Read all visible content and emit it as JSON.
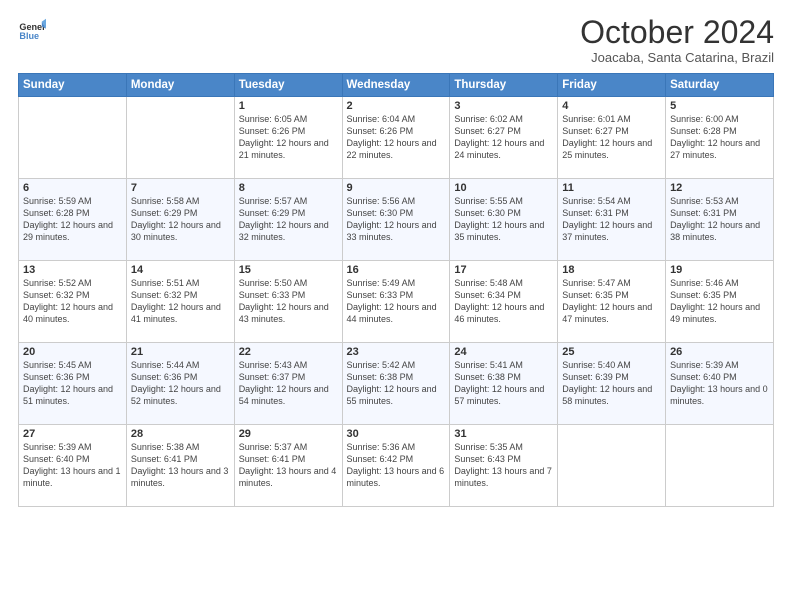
{
  "logo": {
    "line1": "General",
    "line2": "Blue"
  },
  "title": "October 2024",
  "location": "Joacaba, Santa Catarina, Brazil",
  "days_of_week": [
    "Sunday",
    "Monday",
    "Tuesday",
    "Wednesday",
    "Thursday",
    "Friday",
    "Saturday"
  ],
  "weeks": [
    [
      {
        "day": "",
        "info": ""
      },
      {
        "day": "",
        "info": ""
      },
      {
        "day": "1",
        "info": "Sunrise: 6:05 AM\nSunset: 6:26 PM\nDaylight: 12 hours and 21 minutes."
      },
      {
        "day": "2",
        "info": "Sunrise: 6:04 AM\nSunset: 6:26 PM\nDaylight: 12 hours and 22 minutes."
      },
      {
        "day": "3",
        "info": "Sunrise: 6:02 AM\nSunset: 6:27 PM\nDaylight: 12 hours and 24 minutes."
      },
      {
        "day": "4",
        "info": "Sunrise: 6:01 AM\nSunset: 6:27 PM\nDaylight: 12 hours and 25 minutes."
      },
      {
        "day": "5",
        "info": "Sunrise: 6:00 AM\nSunset: 6:28 PM\nDaylight: 12 hours and 27 minutes."
      }
    ],
    [
      {
        "day": "6",
        "info": "Sunrise: 5:59 AM\nSunset: 6:28 PM\nDaylight: 12 hours and 29 minutes."
      },
      {
        "day": "7",
        "info": "Sunrise: 5:58 AM\nSunset: 6:29 PM\nDaylight: 12 hours and 30 minutes."
      },
      {
        "day": "8",
        "info": "Sunrise: 5:57 AM\nSunset: 6:29 PM\nDaylight: 12 hours and 32 minutes."
      },
      {
        "day": "9",
        "info": "Sunrise: 5:56 AM\nSunset: 6:30 PM\nDaylight: 12 hours and 33 minutes."
      },
      {
        "day": "10",
        "info": "Sunrise: 5:55 AM\nSunset: 6:30 PM\nDaylight: 12 hours and 35 minutes."
      },
      {
        "day": "11",
        "info": "Sunrise: 5:54 AM\nSunset: 6:31 PM\nDaylight: 12 hours and 37 minutes."
      },
      {
        "day": "12",
        "info": "Sunrise: 5:53 AM\nSunset: 6:31 PM\nDaylight: 12 hours and 38 minutes."
      }
    ],
    [
      {
        "day": "13",
        "info": "Sunrise: 5:52 AM\nSunset: 6:32 PM\nDaylight: 12 hours and 40 minutes."
      },
      {
        "day": "14",
        "info": "Sunrise: 5:51 AM\nSunset: 6:32 PM\nDaylight: 12 hours and 41 minutes."
      },
      {
        "day": "15",
        "info": "Sunrise: 5:50 AM\nSunset: 6:33 PM\nDaylight: 12 hours and 43 minutes."
      },
      {
        "day": "16",
        "info": "Sunrise: 5:49 AM\nSunset: 6:33 PM\nDaylight: 12 hours and 44 minutes."
      },
      {
        "day": "17",
        "info": "Sunrise: 5:48 AM\nSunset: 6:34 PM\nDaylight: 12 hours and 46 minutes."
      },
      {
        "day": "18",
        "info": "Sunrise: 5:47 AM\nSunset: 6:35 PM\nDaylight: 12 hours and 47 minutes."
      },
      {
        "day": "19",
        "info": "Sunrise: 5:46 AM\nSunset: 6:35 PM\nDaylight: 12 hours and 49 minutes."
      }
    ],
    [
      {
        "day": "20",
        "info": "Sunrise: 5:45 AM\nSunset: 6:36 PM\nDaylight: 12 hours and 51 minutes."
      },
      {
        "day": "21",
        "info": "Sunrise: 5:44 AM\nSunset: 6:36 PM\nDaylight: 12 hours and 52 minutes."
      },
      {
        "day": "22",
        "info": "Sunrise: 5:43 AM\nSunset: 6:37 PM\nDaylight: 12 hours and 54 minutes."
      },
      {
        "day": "23",
        "info": "Sunrise: 5:42 AM\nSunset: 6:38 PM\nDaylight: 12 hours and 55 minutes."
      },
      {
        "day": "24",
        "info": "Sunrise: 5:41 AM\nSunset: 6:38 PM\nDaylight: 12 hours and 57 minutes."
      },
      {
        "day": "25",
        "info": "Sunrise: 5:40 AM\nSunset: 6:39 PM\nDaylight: 12 hours and 58 minutes."
      },
      {
        "day": "26",
        "info": "Sunrise: 5:39 AM\nSunset: 6:40 PM\nDaylight: 13 hours and 0 minutes."
      }
    ],
    [
      {
        "day": "27",
        "info": "Sunrise: 5:39 AM\nSunset: 6:40 PM\nDaylight: 13 hours and 1 minute."
      },
      {
        "day": "28",
        "info": "Sunrise: 5:38 AM\nSunset: 6:41 PM\nDaylight: 13 hours and 3 minutes."
      },
      {
        "day": "29",
        "info": "Sunrise: 5:37 AM\nSunset: 6:41 PM\nDaylight: 13 hours and 4 minutes."
      },
      {
        "day": "30",
        "info": "Sunrise: 5:36 AM\nSunset: 6:42 PM\nDaylight: 13 hours and 6 minutes."
      },
      {
        "day": "31",
        "info": "Sunrise: 5:35 AM\nSunset: 6:43 PM\nDaylight: 13 hours and 7 minutes."
      },
      {
        "day": "",
        "info": ""
      },
      {
        "day": "",
        "info": ""
      }
    ]
  ]
}
